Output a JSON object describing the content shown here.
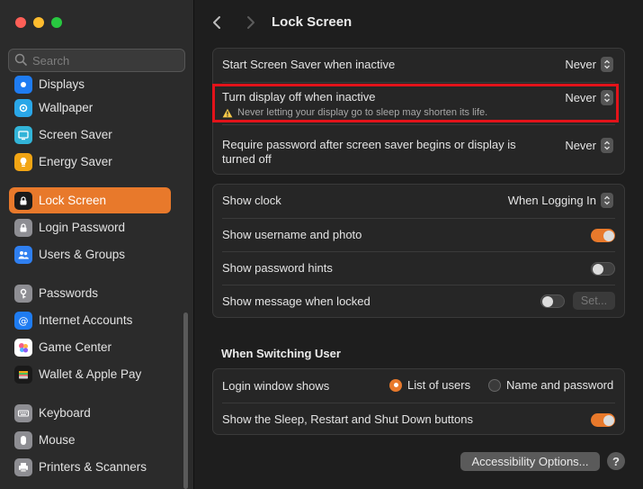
{
  "sidebar": {
    "search_placeholder": "Search",
    "items": [
      {
        "label": "Displays",
        "icon": "displays-icon",
        "color": "#1f7cf2"
      },
      {
        "label": "Wallpaper",
        "icon": "wallpaper-icon",
        "color": "#2aa7e8"
      },
      {
        "label": "Screen Saver",
        "icon": "screen-saver-icon",
        "color": "#32b4d8"
      },
      {
        "label": "Energy Saver",
        "icon": "energy-saver-icon",
        "color": "#f2a514"
      },
      {
        "label": "Lock Screen",
        "icon": "lock-screen-icon",
        "color": "#1a1a1a",
        "active": true
      },
      {
        "label": "Login Password",
        "icon": "login-password-icon",
        "color": "#8e8e93"
      },
      {
        "label": "Users & Groups",
        "icon": "users-groups-icon",
        "color": "#2f7ff0"
      },
      {
        "label": "Passwords",
        "icon": "passwords-icon",
        "color": "#8e8e93"
      },
      {
        "label": "Internet Accounts",
        "icon": "internet-accounts-icon",
        "color": "#1f7cf2"
      },
      {
        "label": "Game Center",
        "icon": "game-center-icon",
        "color": "#ffffff"
      },
      {
        "label": "Wallet & Apple Pay",
        "icon": "wallet-icon",
        "color": "#1a1a1a"
      },
      {
        "label": "Keyboard",
        "icon": "keyboard-icon",
        "color": "#8e8e93"
      },
      {
        "label": "Mouse",
        "icon": "mouse-icon",
        "color": "#8e8e93"
      },
      {
        "label": "Printers & Scanners",
        "icon": "printers-icon",
        "color": "#8e8e93"
      }
    ]
  },
  "header": {
    "title": "Lock Screen"
  },
  "group1": {
    "screen_saver": {
      "label": "Start Screen Saver when inactive",
      "value": "Never"
    },
    "display_off": {
      "label": "Turn display off when inactive",
      "value": "Never",
      "warning": "Never letting your display go to sleep may shorten its life."
    },
    "require_password": {
      "label_line1": "Require password after screen saver begins or display is",
      "label_line2": "turned off",
      "value": "Never"
    }
  },
  "group2": {
    "show_clock": {
      "label": "Show clock",
      "value": "When Logging In"
    },
    "username_photo": {
      "label": "Show username and photo",
      "on": true
    },
    "password_hints": {
      "label": "Show password hints",
      "on": false
    },
    "message_locked": {
      "label": "Show message when locked",
      "on": false,
      "button": "Set..."
    }
  },
  "switching": {
    "title": "When Switching User",
    "login_window": {
      "label": "Login window shows",
      "option1": "List of users",
      "option2": "Name and password",
      "selected": "List of users"
    },
    "sleep_buttons": {
      "label": "Show the Sleep, Restart and Shut Down buttons",
      "on": true
    }
  },
  "footer": {
    "accessibility": "Accessibility Options...",
    "help": "?"
  },
  "colors": {
    "accent": "#e8792b",
    "highlight": "#e3131a"
  }
}
